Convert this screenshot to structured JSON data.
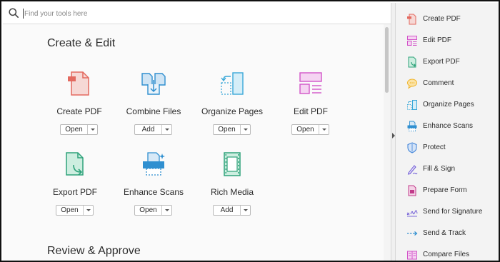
{
  "search": {
    "placeholder": "Find your tools here"
  },
  "sections": {
    "create_edit": "Create & Edit",
    "review_approve": "Review & Approve"
  },
  "tools": [
    {
      "label": "Create PDF",
      "button": "Open",
      "icon": "create-pdf-icon"
    },
    {
      "label": "Combine Files",
      "button": "Add",
      "icon": "combine-files-icon"
    },
    {
      "label": "Organize Pages",
      "button": "Open",
      "icon": "organize-pages-icon"
    },
    {
      "label": "Edit PDF",
      "button": "Open",
      "icon": "edit-pdf-icon"
    },
    {
      "label": "Export PDF",
      "button": "Open",
      "icon": "export-pdf-icon"
    },
    {
      "label": "Enhance Scans",
      "button": "Open",
      "icon": "enhance-scans-icon"
    },
    {
      "label": "Rich Media",
      "button": "Add",
      "icon": "rich-media-icon"
    }
  ],
  "right_panel": [
    {
      "label": "Create PDF",
      "icon": "create-pdf-icon",
      "color": "#e3695f"
    },
    {
      "label": "Edit PDF",
      "icon": "edit-pdf-icon",
      "color": "#d254c8"
    },
    {
      "label": "Export PDF",
      "icon": "export-pdf-icon",
      "color": "#2ea27a"
    },
    {
      "label": "Comment",
      "icon": "comment-icon",
      "color": "#f0b429"
    },
    {
      "label": "Organize Pages",
      "icon": "organize-pages-icon",
      "color": "#3aa8d8"
    },
    {
      "label": "Enhance Scans",
      "icon": "enhance-scans-icon",
      "color": "#2f8fd0"
    },
    {
      "label": "Protect",
      "icon": "protect-icon",
      "color": "#3a7fd6"
    },
    {
      "label": "Fill & Sign",
      "icon": "fill-sign-icon",
      "color": "#6e5ad6"
    },
    {
      "label": "Prepare Form",
      "icon": "prepare-form-icon",
      "color": "#c13a8a"
    },
    {
      "label": "Send for Signature",
      "icon": "send-for-signature-icon",
      "color": "#6e5ad6"
    },
    {
      "label": "Send & Track",
      "icon": "send-track-icon",
      "color": "#2f8fd0"
    },
    {
      "label": "Compare Files",
      "icon": "compare-files-icon",
      "color": "#d254c8"
    }
  ]
}
